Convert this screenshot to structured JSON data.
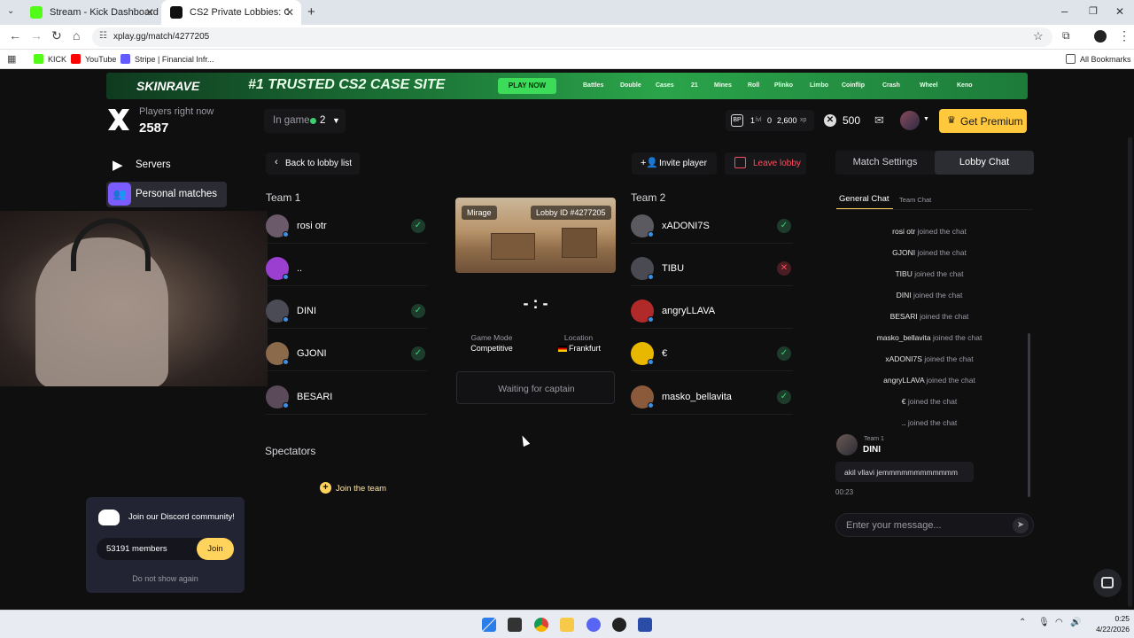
{
  "browser": {
    "tabs": [
      {
        "title": "Stream - Kick Dashboard",
        "active": false
      },
      {
        "title": "CS2 Private Lobbies: Custom M",
        "active": true
      }
    ],
    "url": "xplay.gg/match/4277205",
    "bookmarks": [
      "KICK",
      "YouTube",
      "Stripe | Financial Infr...",
      "All Bookmarks"
    ]
  },
  "banner": {
    "brand": "SKINRAVE",
    "headline": "#1 TRUSTED CS2 CASE SITE",
    "cta": "PLAY NOW",
    "categories": [
      "Battles",
      "Double",
      "Cases",
      "21",
      "Mines",
      "Roll",
      "Plinko",
      "Limbo",
      "Coinflip",
      "Crash",
      "Wheel",
      "Keno"
    ]
  },
  "sidebar": {
    "players_label": "Players right now",
    "players_count": "2587",
    "nav": [
      {
        "label": "Servers",
        "active": false
      },
      {
        "label": "Personal matches",
        "active": true
      }
    ],
    "discord": {
      "title": "Join our Discord community!",
      "members": "53191 members",
      "join": "Join",
      "dismiss": "Do not show again"
    }
  },
  "topbar": {
    "in_game_label": "In game",
    "in_game_count": "2",
    "level": "1",
    "level_suffix": "lvl",
    "xp_current": "0",
    "xp_total": "2,600",
    "xp_suffix": "xp",
    "coins": "500",
    "premium": "Get Premium"
  },
  "lobby": {
    "back": "Back to lobby list",
    "invite": "Invite player",
    "leave": "Leave lobby",
    "team1_title": "Team 1",
    "team2_title": "Team 2",
    "team1": [
      {
        "name": "rosi otr",
        "ready": true
      },
      {
        "name": "..",
        "ready": false
      },
      {
        "name": "DINI",
        "ready": true
      },
      {
        "name": "GJONI",
        "ready": true
      },
      {
        "name": "BESARI",
        "ready": false
      }
    ],
    "team2": [
      {
        "name": "xADONI7S",
        "ready": true
      },
      {
        "name": "TIBU",
        "ready": false,
        "declined": true
      },
      {
        "name": "angryLLAVA",
        "ready": false
      },
      {
        "name": "€",
        "ready": true
      },
      {
        "name": "masko_bellavita",
        "ready": true
      }
    ],
    "map": "Mirage",
    "lobby_id": "Lobby ID #4277205",
    "score": "- : -",
    "game_mode_label": "Game Mode",
    "game_mode": "Competitive",
    "location_label": "Location",
    "location": "Frankfurt",
    "waiting": "Waiting for captain",
    "spectators": "Spectators",
    "join_team": "Join the team"
  },
  "chat": {
    "tabs": [
      "Match Settings",
      "Lobby Chat"
    ],
    "subtabs": [
      "General Chat",
      "Team Chat"
    ],
    "joined_suffix": "joined the chat",
    "joined": [
      "rosi otr",
      "GJONI",
      "TIBU",
      "DINI",
      "BESARI",
      "masko_bellavita",
      "xADONI7S",
      "angryLLAVA",
      "€",
      ".."
    ],
    "message": {
      "team": "Team 1",
      "user": "DINI",
      "text": "akil vllavi jemmmmmmmmmmmm",
      "time": "00:23"
    },
    "input_placeholder": "Enter your message..."
  },
  "taskbar": {
    "time": "0:25",
    "date": "4/22/2026"
  }
}
